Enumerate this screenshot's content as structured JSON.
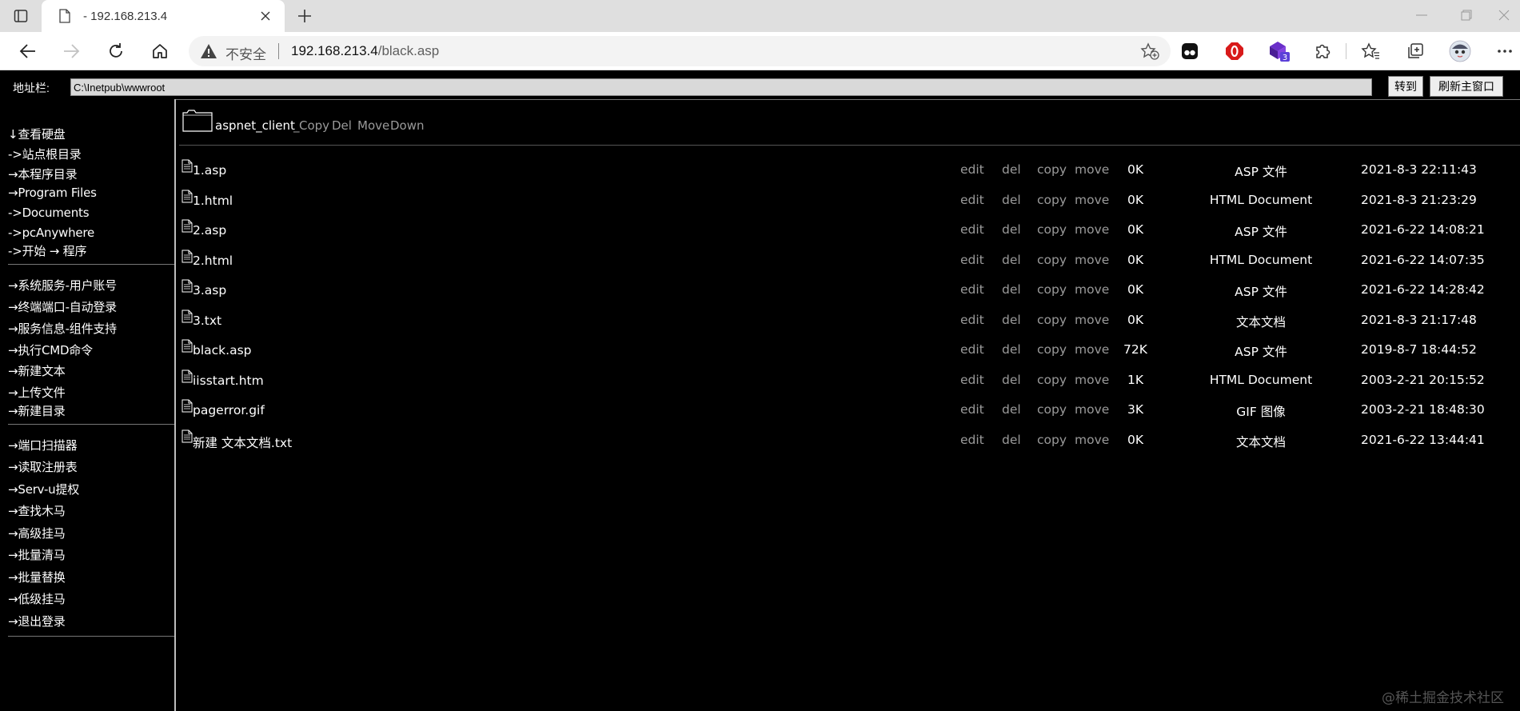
{
  "browser": {
    "tab_title": "- 192.168.213.4",
    "insecure_label": "不安全",
    "url_host": "192.168.213.4",
    "url_path": "/black.asp",
    "extension_badge": "3"
  },
  "page": {
    "address_label": "地址栏:",
    "address_value": "C:\\Inetpub\\wwwroot",
    "go_label": "转到",
    "refresh_label": "刷新主窗口"
  },
  "sidebar": {
    "group1": [
      "↓查看硬盘",
      "->站点根目录",
      "→本程序目录",
      "→Program Files",
      "->Documents",
      "->pcAnywhere",
      "->开始 → 程序"
    ],
    "group2": [
      "→系统服务-用户账号",
      "→终端端口-自动登录",
      "→服务信息-组件支持",
      "→执行CMD命令",
      "→新建文本",
      "→上传文件",
      "→新建目录"
    ],
    "group3": [
      "→端口扫描器",
      "→读取注册表",
      "→Serv-u提权",
      "→查找木马",
      "→高级挂马",
      "→批量清马",
      "→批量替换",
      "→低级挂马",
      "→退出登录"
    ]
  },
  "folder": {
    "name": "aspnet_client",
    "separator": "_",
    "actions": [
      "Copy",
      "Del",
      "Move",
      "Down"
    ]
  },
  "file_actions": [
    "edit",
    "del",
    "copy",
    "move"
  ],
  "files": [
    {
      "name": "1.asp",
      "size": "0K",
      "type": "ASP 文件",
      "date": "2021-8-3 22:11:43"
    },
    {
      "name": "1.html",
      "size": "0K",
      "type": "HTML Document",
      "date": "2021-8-3 21:23:29"
    },
    {
      "name": "2.asp",
      "size": "0K",
      "type": "ASP 文件",
      "date": "2021-6-22 14:08:21"
    },
    {
      "name": "2.html",
      "size": "0K",
      "type": "HTML Document",
      "date": "2021-6-22 14:07:35"
    },
    {
      "name": "3.asp",
      "size": "0K",
      "type": "ASP 文件",
      "date": "2021-6-22 14:28:42"
    },
    {
      "name": "3.txt",
      "size": "0K",
      "type": "文本文档",
      "date": "2021-8-3 21:17:48"
    },
    {
      "name": "black.asp",
      "size": "72K",
      "type": "ASP 文件",
      "date": "2019-8-7 18:44:52"
    },
    {
      "name": "iisstart.htm",
      "size": "1K",
      "type": "HTML Document",
      "date": "2003-2-21 20:15:52"
    },
    {
      "name": "pagerror.gif",
      "size": "3K",
      "type": "GIF 图像",
      "date": "2003-2-21 18:48:30"
    },
    {
      "name": "新建 文本文档.txt",
      "size": "0K",
      "type": "文本文档",
      "date": "2021-6-22 13:44:41"
    }
  ],
  "watermark": "@稀土掘金技术社区"
}
